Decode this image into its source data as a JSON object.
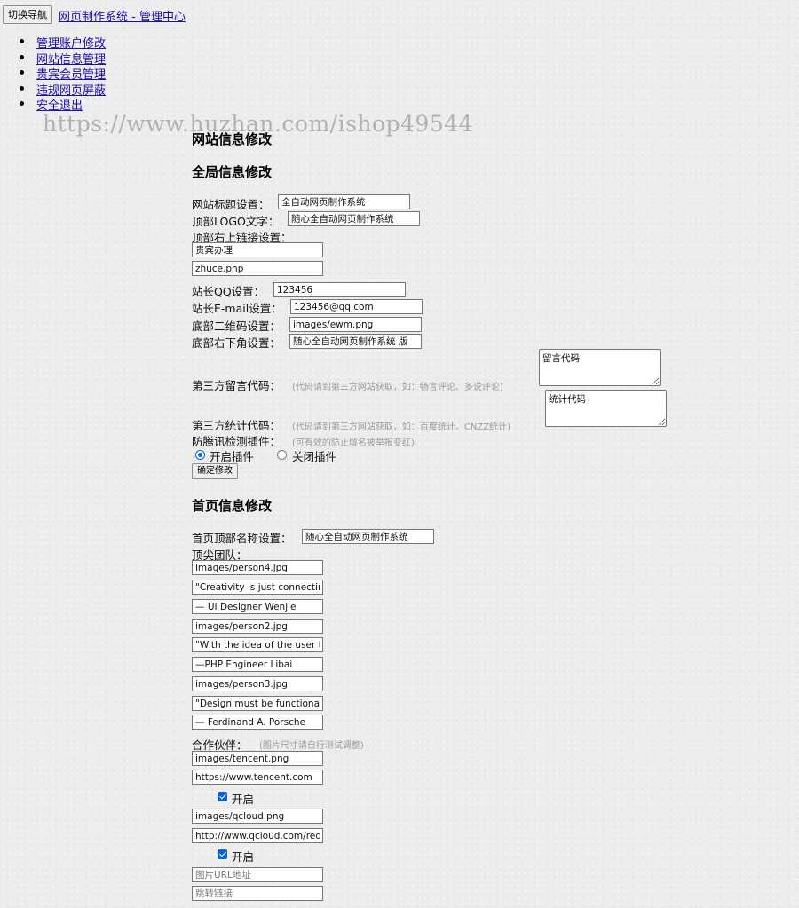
{
  "topbar": {
    "toggle_label": "切换导航",
    "site_title": "网页制作系统 - 管理中心"
  },
  "nav": {
    "items": [
      "管理账户修改",
      "网站信息管理",
      "贵宾会员管理",
      "违规网页屏蔽",
      "安全退出"
    ]
  },
  "watermark": "https://www.huzhan.com/ishop49544",
  "page_title": "网站信息修改",
  "global": {
    "heading": "全局信息修改",
    "site_title_label": "网站标题设置：",
    "site_title_value": "全自动网页制作系统",
    "logo_label": "顶部LOGO文字：",
    "logo_value": "随心全自动网页制作系统",
    "top_links_label": "顶部右上链接设置：",
    "top_link1": "贵宾办理",
    "top_link2": "zhuce.php",
    "qq_label": "站长QQ设置：",
    "qq_value": "123456",
    "email_label": "站长E-mail设置：",
    "email_value": "123456@qq.com",
    "qrcode_label": "底部二维码设置：",
    "qrcode_value": "images/ewm.png",
    "footer_label": "底部右下角设置：",
    "footer_value": "随心全自动网页制作系统 版",
    "comment_label": "第三方留言代码：",
    "comment_hint": "(代码请到第三方网站获取，如：畅言评论、多说评论)",
    "comment_value": "留言代码",
    "stats_label": "第三方统计代码：",
    "stats_hint": "(代码请到第三方网站获取，如：百度统计、CNZZ统计)",
    "stats_value": "统计代码",
    "plugin_label": "防腾讯检测插件：",
    "plugin_hint": "(可有效的防止域名被举报变红)",
    "plugin_on": "开启插件",
    "plugin_off": "关闭插件",
    "submit": "确定修改"
  },
  "home": {
    "heading": "首页信息修改",
    "top_name_label": "首页顶部名称设置：",
    "top_name_value": "随心全自动网页制作系统",
    "team_label": "顶尖团队：",
    "team": [
      "images/person4.jpg",
      "\"Creativity is just connecting",
      "— UI Designer Wenjie",
      "images/person2.jpg",
      "\"With the idea of the user to :",
      "—PHP Engineer Libai",
      "images/person3.jpg",
      "\"Design must be functional a",
      "— Ferdinand A. Porsche"
    ],
    "partners_label": "合作伙伴：",
    "partners_hint": "(图片尺寸请自行测试调整)",
    "partner1_img": "images/tencent.png",
    "partner1_url": "https://www.tencent.com",
    "partner1_enable": "开启",
    "partner2_img": "images/qcloud.png",
    "partner2_url": "http://www.qcloud.com/redire",
    "partner2_enable": "开启",
    "partner3_img_placeholder": "图片URL地址",
    "partner3_url_placeholder": "跳转链接"
  }
}
